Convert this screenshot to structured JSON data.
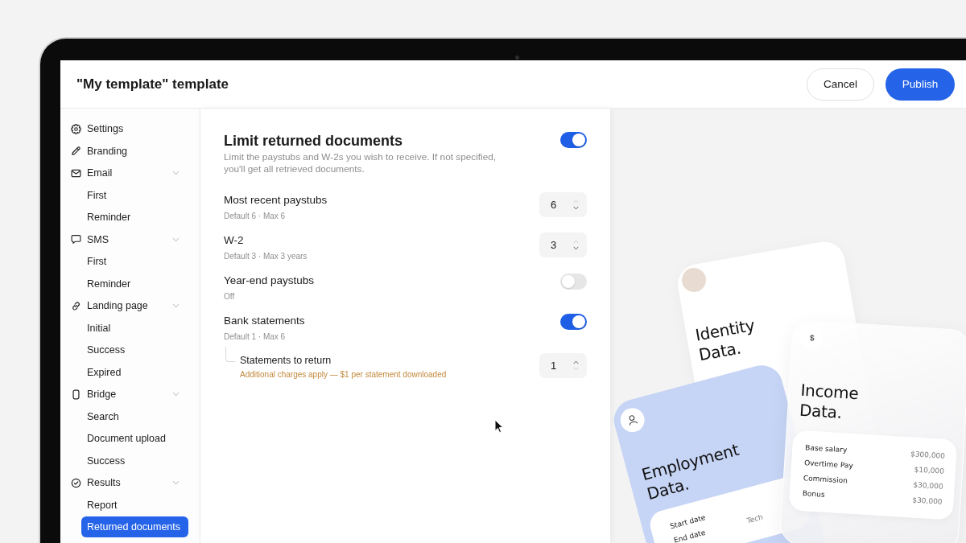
{
  "window": {
    "title": "\"My template\" template"
  },
  "header": {
    "buttons": [
      {
        "label": "Cancel",
        "kind": "secondary"
      },
      {
        "label": "Publish",
        "kind": "primary"
      }
    ]
  },
  "sidebar": {
    "items": [
      {
        "label": "Settings",
        "selected": false
      },
      {
        "label": "Branding",
        "selected": false
      },
      {
        "label": "Email",
        "selected": false,
        "expanded": true,
        "children": [
          {
            "label": "First",
            "selected": false
          },
          {
            "label": "Reminder",
            "selected": false
          }
        ]
      },
      {
        "label": "SMS",
        "selected": false,
        "expanded": true,
        "children": [
          {
            "label": "First",
            "selected": false
          },
          {
            "label": "Reminder",
            "selected": false
          }
        ]
      },
      {
        "label": "Landing page",
        "selected": false,
        "expanded": true,
        "children": [
          {
            "label": "Initial",
            "selected": false
          },
          {
            "label": "Success",
            "selected": false
          },
          {
            "label": "Expired",
            "selected": false
          }
        ]
      },
      {
        "label": "Bridge",
        "selected": false,
        "expanded": true,
        "children": [
          {
            "label": "Search",
            "selected": false
          },
          {
            "label": "Document upload",
            "selected": false
          },
          {
            "label": "Success",
            "selected": false
          }
        ]
      },
      {
        "label": "Results",
        "selected": false,
        "expanded": true,
        "children": [
          {
            "label": "Report",
            "selected": false
          },
          {
            "label": "Returned documents",
            "selected": true
          }
        ]
      }
    ]
  },
  "section": {
    "title": "Limit returned documents",
    "on": true,
    "description": "Limit the paystubs and W-2s you wish to receive. If not specified, you'll get all retrieved documents.",
    "options": [
      {
        "kind": "stepper",
        "label": "Most recent paystubs",
        "hint": "Default 6 · Max 6",
        "value": "6",
        "increment_disabled": true,
        "decrement_disabled": false
      },
      {
        "kind": "stepper",
        "label": "W-2",
        "hint": "Default 3 · Max 3 years",
        "value": "3",
        "increment_disabled": true,
        "decrement_disabled": false
      },
      {
        "kind": "toggle",
        "label": "Year-end paystubs",
        "hint": "Off",
        "on": false
      },
      {
        "kind": "toggle",
        "label": "Bank statements",
        "hint": "Default 1 · Max 6",
        "on": true,
        "children": [
          {
            "kind": "stepper",
            "label": "Statements to return",
            "note": "Additional charges apply — $1 per statement downloaded",
            "value": "1",
            "increment_disabled": false,
            "decrement_disabled": true
          }
        ]
      }
    ]
  },
  "preview": {
    "cards": [
      {
        "kind": "identity",
        "title": "Identity Data."
      },
      {
        "kind": "employment",
        "title": "Employment Data.",
        "rows": [
          {
            "label": "Start date"
          },
          {
            "label": "End date"
          }
        ],
        "column_2": [
          "Tech"
        ]
      },
      {
        "kind": "income",
        "symbol": "$",
        "title": "Income Data.",
        "rows": [
          {
            "label": "Base salary",
            "value": "$300,000"
          },
          {
            "label": "Overtime Pay",
            "value": "$10,000"
          },
          {
            "label": "Commission",
            "value": "$30,000"
          },
          {
            "label": "Bonus",
            "value": "$30,000"
          }
        ]
      }
    ]
  }
}
